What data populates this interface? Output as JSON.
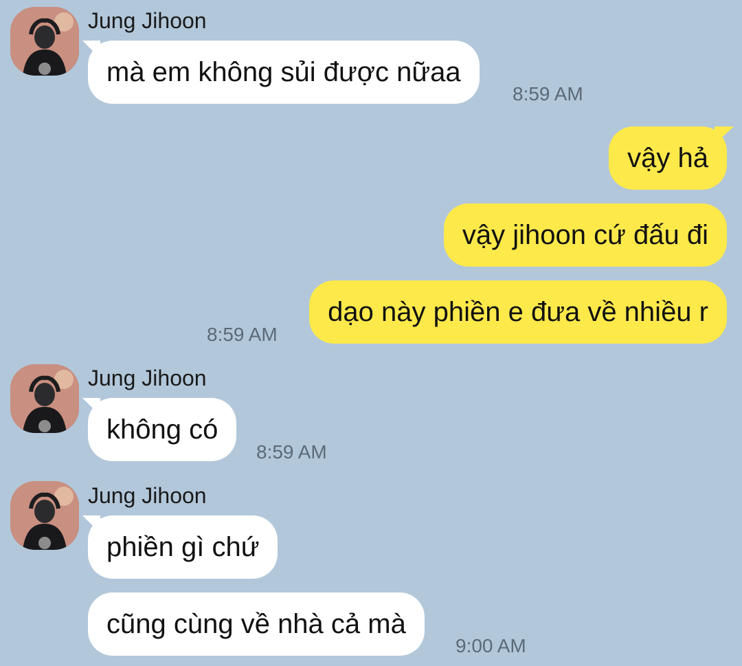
{
  "messages": [
    {
      "sender": "Jung Jihoon",
      "text": "mà em không sủi được nữaa",
      "time": "8:59 AM"
    },
    {
      "text": "vậy hả"
    },
    {
      "text": "vậy jihoon cứ đấu đi"
    },
    {
      "text": "dạo này phiền e đưa về nhiều r",
      "time": "8:59 AM"
    },
    {
      "sender": "Jung Jihoon",
      "text": "không có",
      "time": "8:59 AM"
    },
    {
      "sender": "Jung Jihoon",
      "text": "phiền gì chứ"
    },
    {
      "text": "cũng cùng về nhà cả mà",
      "time": "9:00 AM"
    }
  ],
  "colors": {
    "background": "#b2c7da",
    "incoming_bubble": "#ffffff",
    "outgoing_bubble": "#fee94a"
  },
  "icons": {
    "avatar": "avatar-icon"
  }
}
